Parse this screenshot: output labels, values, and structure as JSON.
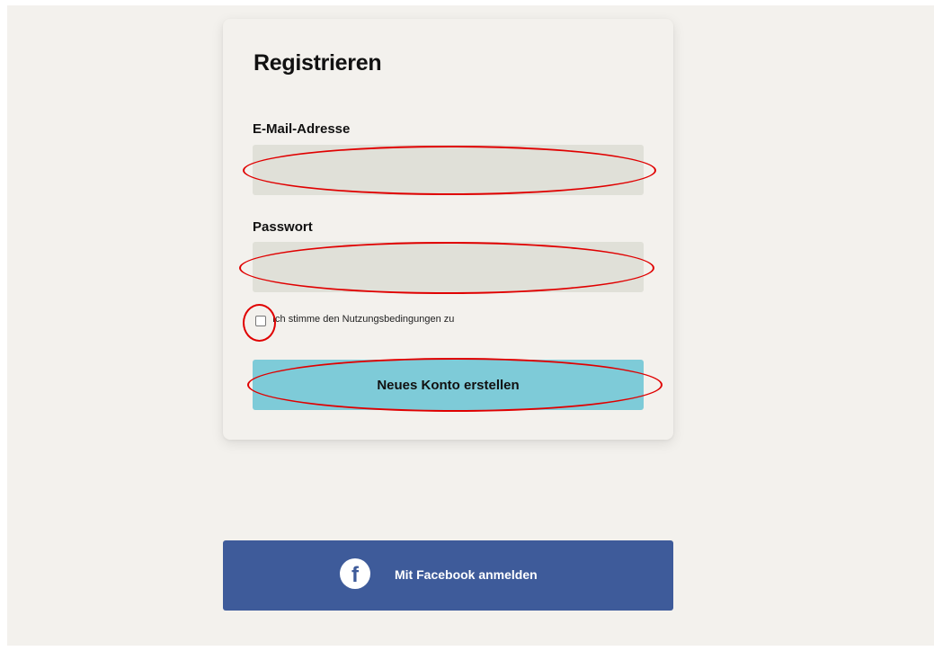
{
  "register_form": {
    "title": "Registrieren",
    "email_label": "E-Mail-Adresse",
    "email_value": "",
    "password_label": "Passwort",
    "password_value": "",
    "terms_checked": false,
    "terms_label": "Ich stimme den Nutzungsbedingungen zu",
    "submit_label": "Neues Konto erstellen"
  },
  "social_login": {
    "facebook_label": "Mit Facebook anmelden",
    "icon_glyph": "f"
  },
  "annotation_color": "#e00000",
  "colors": {
    "background": "#f3f1ed",
    "input_background": "#e0e0d8",
    "submit_button": "#7ecbd8",
    "facebook_button": "#3e5b9a"
  }
}
